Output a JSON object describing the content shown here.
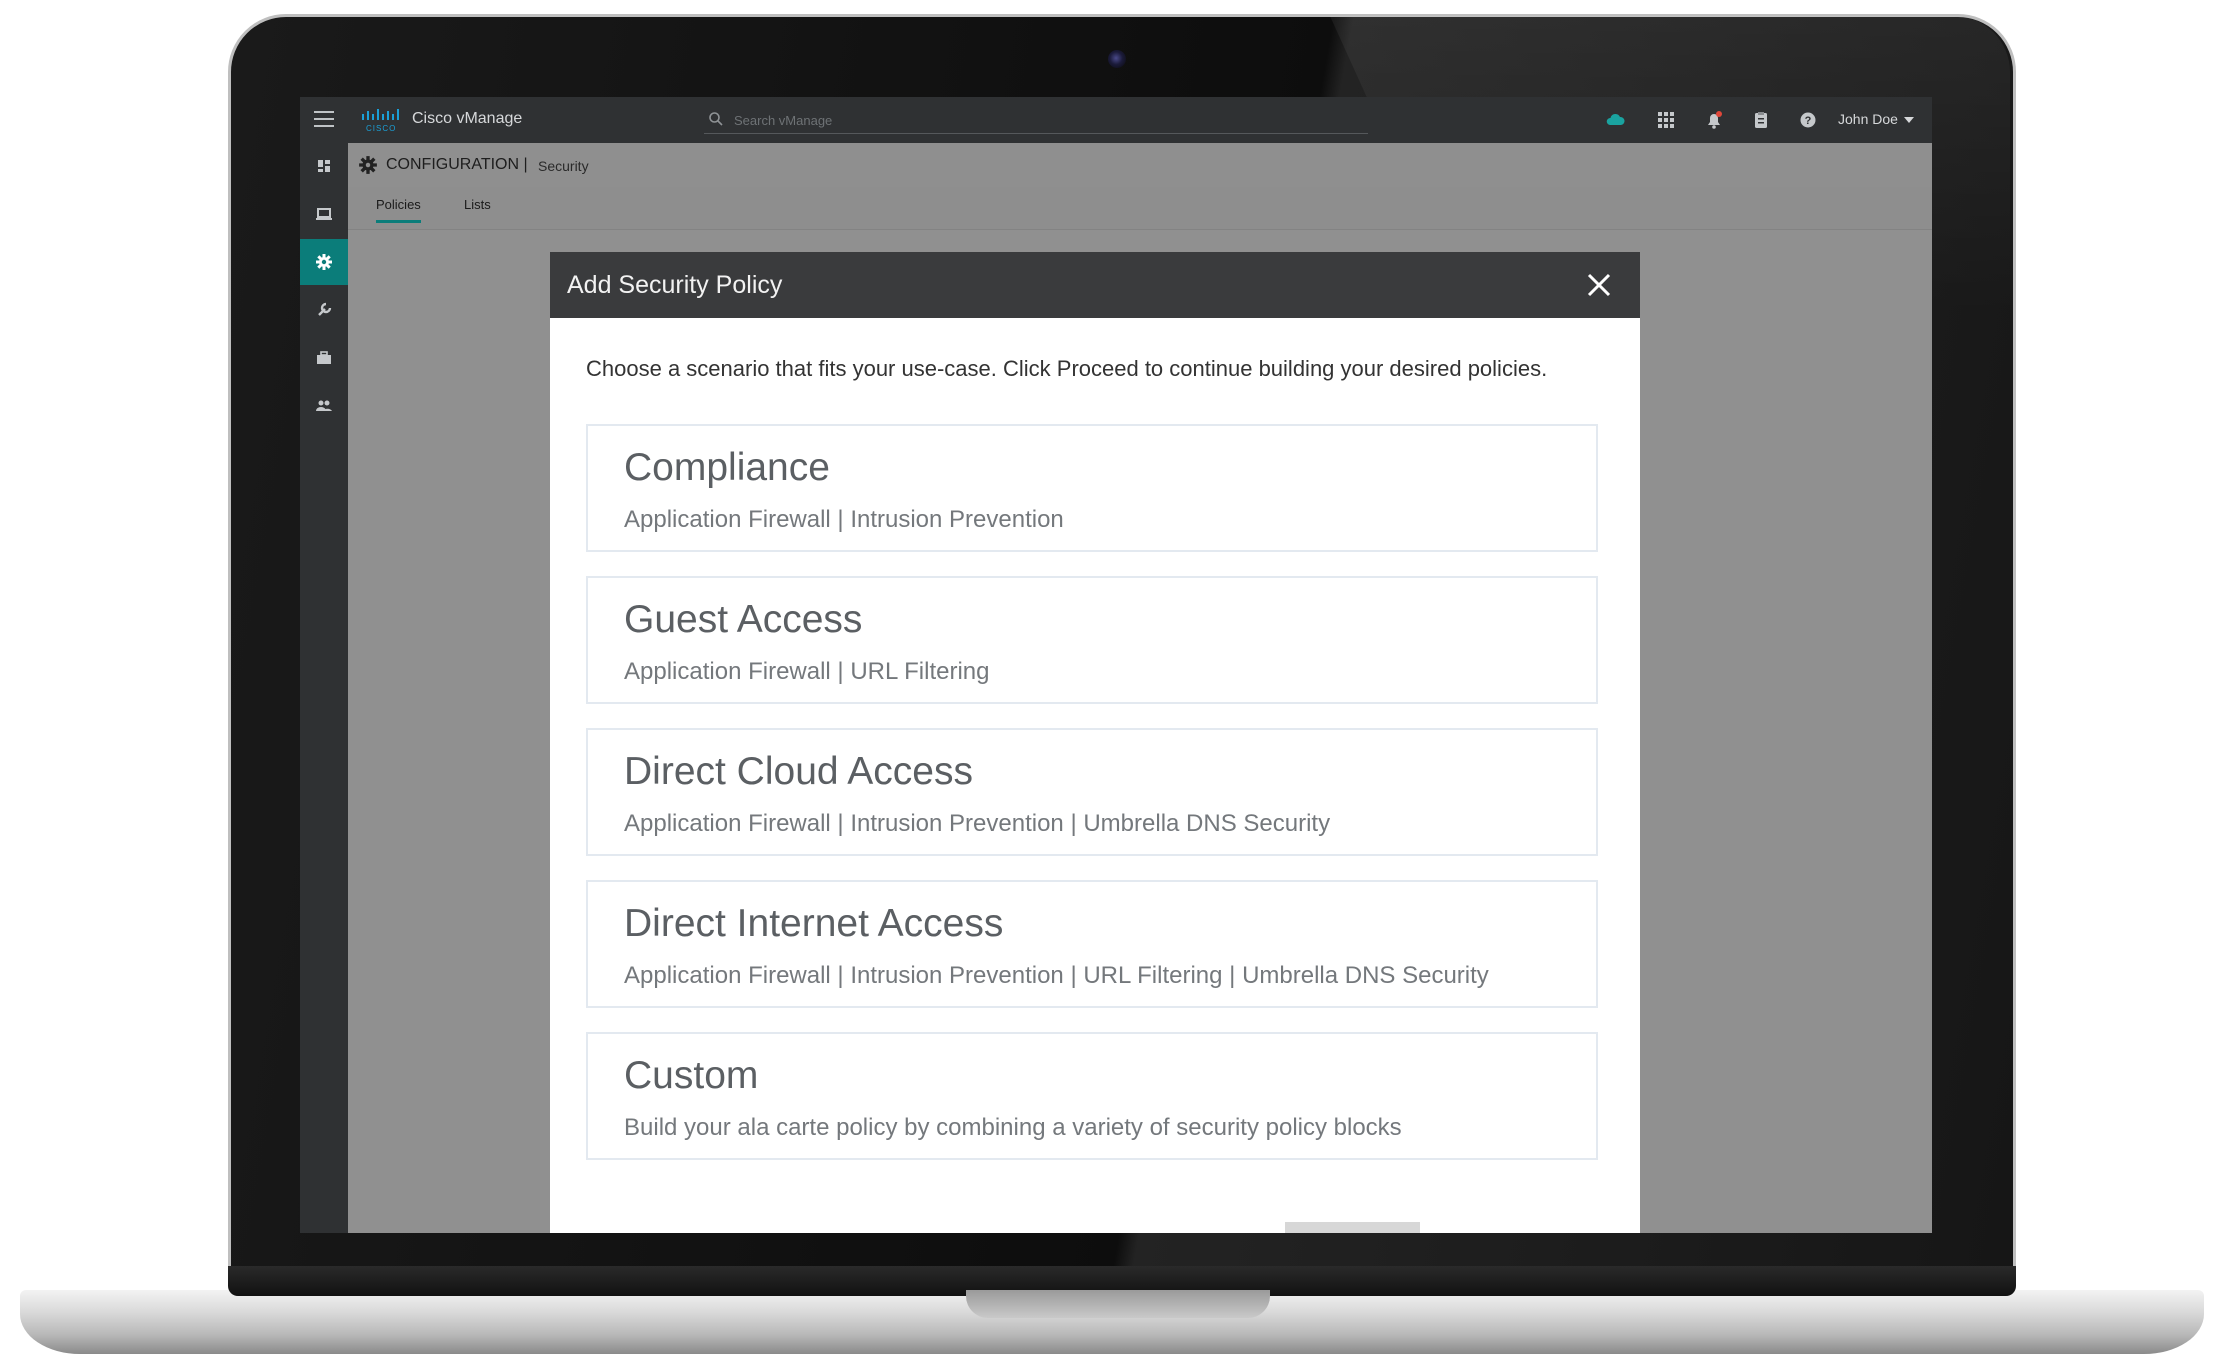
{
  "app": {
    "brand": "Cisco vManage",
    "search_placeholder": "Search vManage",
    "user": "John Doe"
  },
  "breadcrumb": {
    "section": "CONFIGURATION |",
    "page": "Security"
  },
  "tabs": [
    {
      "label": "Policies",
      "active": true
    },
    {
      "label": "Lists",
      "active": false
    }
  ],
  "sidenav": {
    "items": [
      "dashboard-icon",
      "monitor-icon",
      "configuration-icon",
      "tools-icon",
      "maintenance-icon",
      "administration-icon"
    ],
    "active_index": 2
  },
  "modal": {
    "title": "Add Security Policy",
    "intro": "Choose a scenario that fits your use-case. Click Proceed to continue building your desired policies.",
    "scenarios": [
      {
        "title": "Compliance",
        "desc": "Application Firewall | Intrusion Prevention"
      },
      {
        "title": "Guest Access",
        "desc": "Application Firewall | URL Filtering"
      },
      {
        "title": "Direct Cloud Access",
        "desc": "Application Firewall | Intrusion Prevention | Umbrella DNS Security"
      },
      {
        "title": "Direct Internet Access",
        "desc": "Application Firewall | Intrusion Prevention | URL Filtering | Umbrella DNS Security"
      },
      {
        "title": "Custom",
        "desc": "Build your ala carte policy by combining a variety of security policy blocks"
      }
    ]
  },
  "colors": {
    "accent": "#0b7d7a",
    "topbar": "#2f3133",
    "modal_header": "#3a3b3d",
    "cloud_status": "#1aa3a0",
    "alert": "#e0473a"
  }
}
